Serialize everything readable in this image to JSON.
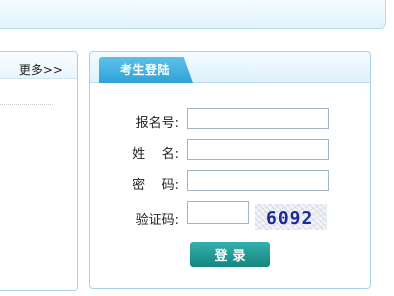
{
  "news": {
    "more_label": "更多>>"
  },
  "login": {
    "tab_title": "考生登陆",
    "fields": [
      {
        "label": "报名号:",
        "value": ""
      },
      {
        "label": "姓    名:",
        "value": ""
      },
      {
        "label": "密    码:",
        "value": ""
      },
      {
        "label": "验证码:",
        "value": ""
      }
    ],
    "captcha_text": "6092",
    "submit_label": "登录"
  },
  "colors": {
    "accent": "#2ea2d8",
    "border": "#a9d2e8",
    "button": "#1b8f89"
  }
}
